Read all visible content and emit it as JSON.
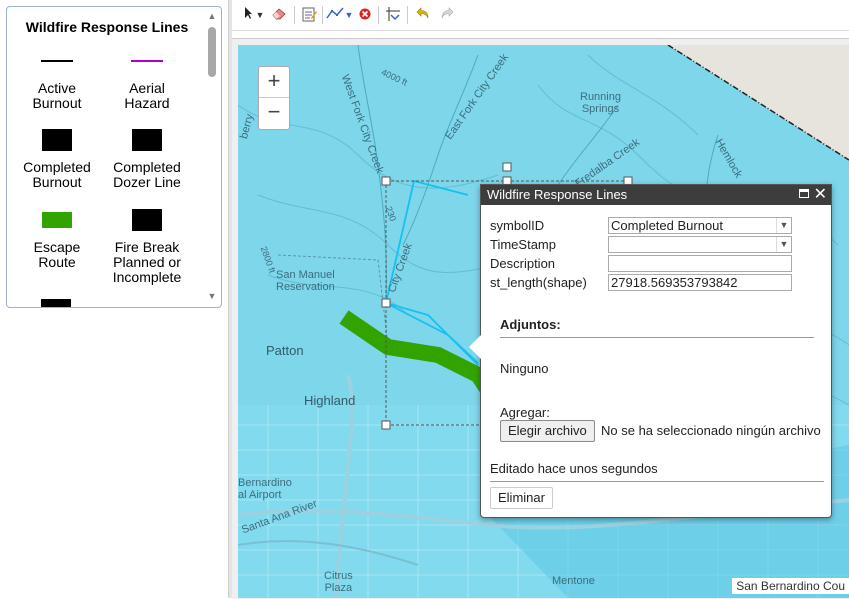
{
  "legend": {
    "title": "Wildfire Response Lines",
    "items": [
      {
        "label": "Active\nBurnout",
        "symbol": "line",
        "color": "#000000"
      },
      {
        "label": "Aerial\nHazard",
        "symbol": "line",
        "color": "#b000d0"
      },
      {
        "label": "Completed\nBurnout",
        "symbol": "box",
        "color": "#000000"
      },
      {
        "label": "Completed\nDozer Line",
        "symbol": "box",
        "color": "#000000"
      },
      {
        "label": "Escape\nRoute",
        "symbol": "box",
        "color": "#33a300"
      },
      {
        "label": "Fire Break\nPlanned or\nIncomplete",
        "symbol": "box",
        "color": "#000000"
      }
    ]
  },
  "toolbar": {
    "buttons": [
      "select-icon",
      "dropdown-icon",
      "eraser-icon",
      "attributes-icon",
      "edit-vertices-icon",
      "dropdown-icon",
      "delete-icon",
      "cut-icon",
      "undo-icon",
      "redo-icon"
    ]
  },
  "map": {
    "zoom_in": "+",
    "zoom_out": "−",
    "labels": {
      "west_fork": "West Fork City Creek",
      "east_fork": "East Fork City Creek",
      "running_springs": "Running\nSprings",
      "fredalba": "Fredalba Creek",
      "hemlock": "Hemlock",
      "patton": "Patton",
      "highland": "Highland",
      "san_manuel": "San Manuel\nReservation",
      "bernardino_airport": "Bernardino\nal Airport",
      "santa_ana": "Santa Ana River",
      "citrus_plaza": "Citrus\nPlaza",
      "mentone": "Mentone",
      "elev_4000": "4000 ft",
      "elev_2800": "2800 ft",
      "elev_230": "230",
      "city_creek": "City Creek",
      "berry": "berry"
    },
    "attribution": "San Bernardino Cou"
  },
  "popup": {
    "title": "Wildfire Response Lines",
    "fields": [
      {
        "label": "symbolID",
        "value": "Completed Burnout",
        "type": "select"
      },
      {
        "label": "TimeStamp",
        "value": "",
        "type": "select"
      },
      {
        "label": "Description",
        "value": "",
        "type": "text"
      },
      {
        "label": "st_length(shape)",
        "value": "27918.569353793842",
        "type": "text"
      }
    ],
    "attachments_title": "Adjuntos:",
    "attachments_none": "Ninguno",
    "add_label": "Agregar:",
    "choose_file": "Elegir archivo",
    "no_file": "No se ha seleccionado ningún archivo",
    "edited": "Editado hace unos segundos",
    "delete": "Eliminar"
  },
  "colors": {
    "map_water_overlay": "#7dd6ea",
    "escape_route": "#33a300",
    "selected_line": "#18c0f0",
    "popup_header": "#3d3d3d"
  }
}
